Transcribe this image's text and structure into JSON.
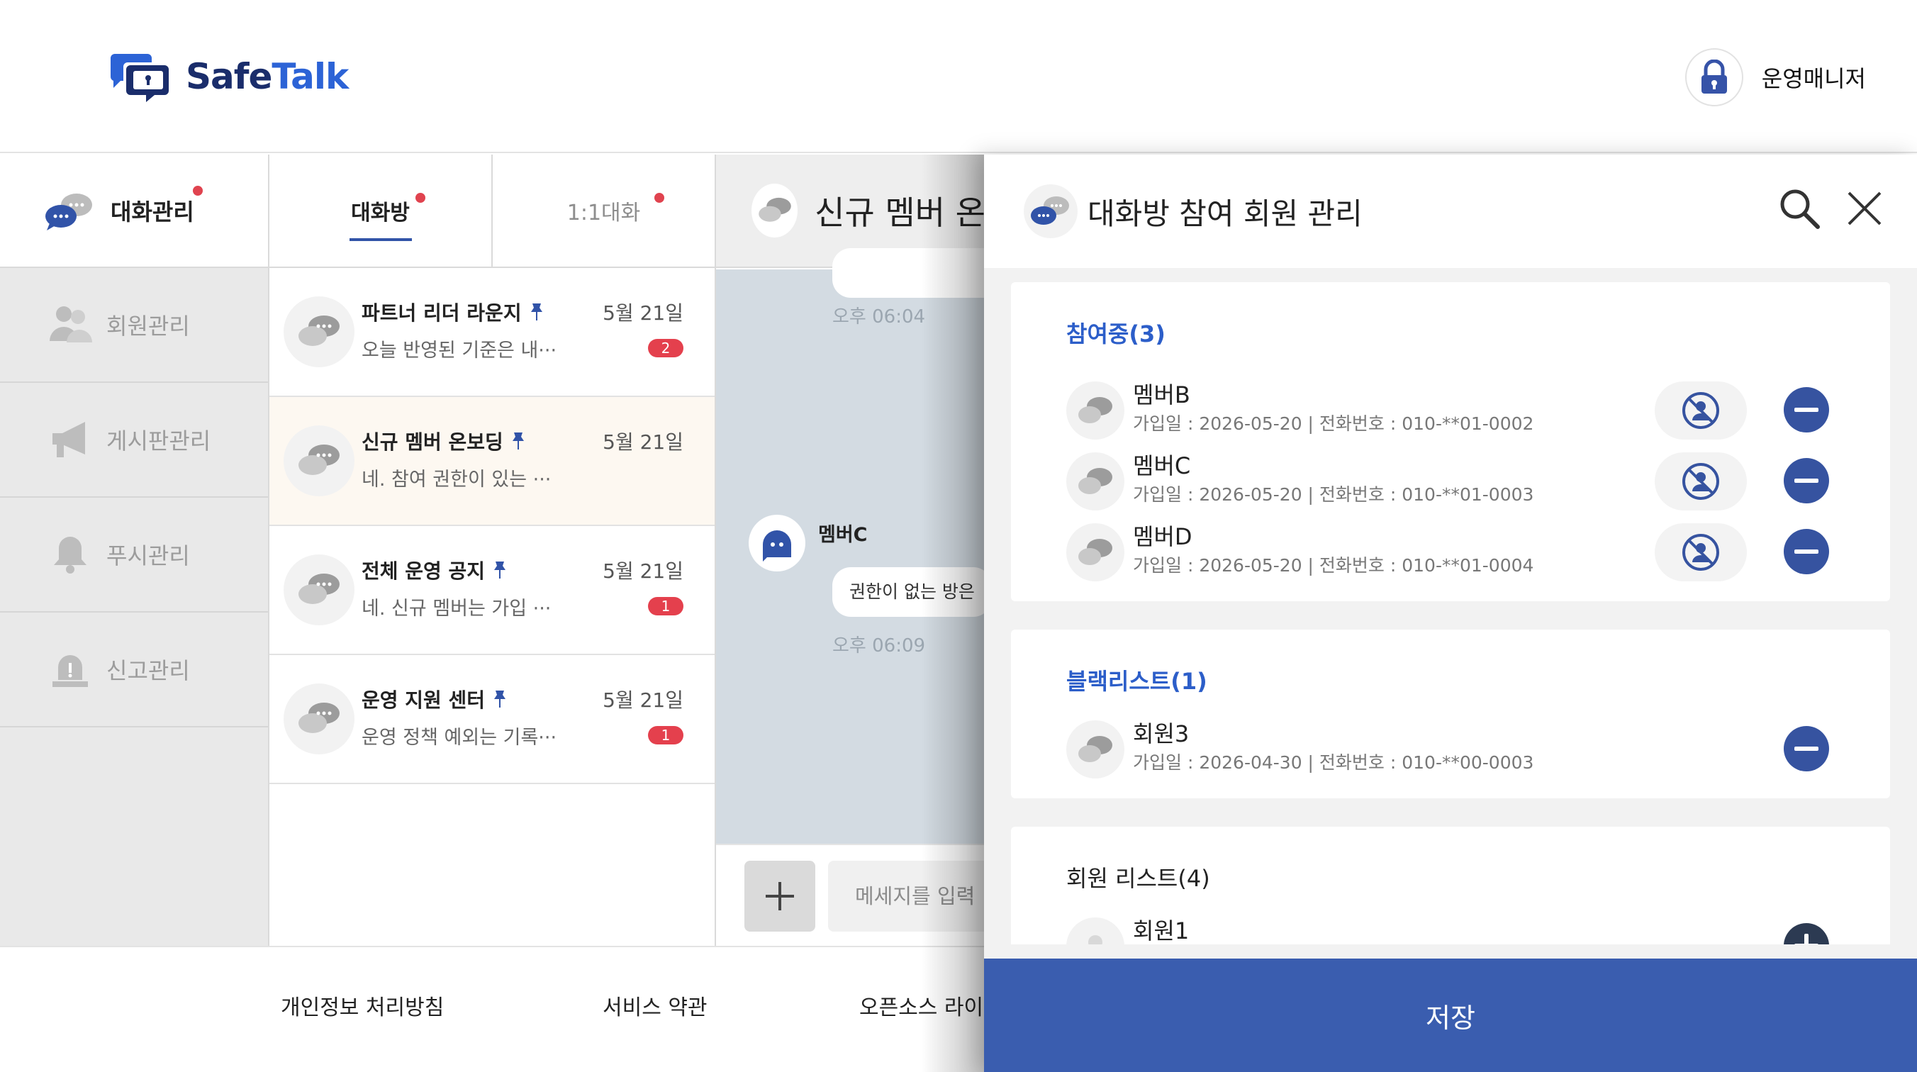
{
  "header": {
    "logo_text_a": "Safe",
    "logo_text_b": "Talk",
    "user_name": "운영매니저"
  },
  "sidebar": {
    "title": "대화관리",
    "items": [
      {
        "label": "회원관리",
        "icon": "members-icon"
      },
      {
        "label": "게시판관리",
        "icon": "megaphone-icon"
      },
      {
        "label": "푸시관리",
        "icon": "bell-icon"
      },
      {
        "label": "신고관리",
        "icon": "alarm-light-icon"
      }
    ]
  },
  "room_tabs": [
    {
      "label": "대화방",
      "active": true
    },
    {
      "label": "1:1대화",
      "active": false
    }
  ],
  "rooms": [
    {
      "name": "파트너 리더 라운지",
      "preview": "오늘 반영된 기준은 내···",
      "date": "5월 21일",
      "badge": "2"
    },
    {
      "name": "신규 멤버 온보딩",
      "preview": "네. 참여 권한이 있는 ···",
      "date": "5월 21일",
      "badge": ""
    },
    {
      "name": "전체 운영 공지",
      "preview": "네. 신규 멤버는 가입 ···",
      "date": "5월 21일",
      "badge": "1"
    },
    {
      "name": "운영 지원 센터",
      "preview": "운영 정책 예외는 기록···",
      "date": "5월 21일",
      "badge": "1"
    }
  ],
  "chat": {
    "title": "신규 멤버 온",
    "time1": "오후 06:04",
    "sender": "멤버C",
    "message": "권한이 없는 방은",
    "time2": "오후 06:09",
    "input_placeholder": "메세지를 입력"
  },
  "footer": {
    "privacy": "개인정보 처리방침",
    "terms": "서비스 약관",
    "opensource": "오픈소스 라이"
  },
  "panel": {
    "title": "대화방 참여 회원 관리",
    "participating": {
      "title": "참여중(3)",
      "members": [
        {
          "name": "멤버B",
          "info": "가입일 : 2026-05-20 | 전화번호 : 010-**01-0002"
        },
        {
          "name": "멤버C",
          "info": "가입일 : 2026-05-20 | 전화번호 : 010-**01-0003"
        },
        {
          "name": "멤버D",
          "info": "가입일 : 2026-05-20 | 전화번호 : 010-**01-0004"
        }
      ]
    },
    "blacklist": {
      "title": "블랙리스트(1)",
      "members": [
        {
          "name": "회원3",
          "info": "가입일 : 2026-04-30 | 전화번호 : 010-**00-0003"
        }
      ]
    },
    "member_list": {
      "title": "회원 리스트(4)",
      "members": [
        {
          "name": "회원1",
          "info": ""
        }
      ]
    },
    "save_label": "저장"
  },
  "colors": {
    "brand_navy": "#1a2d6b",
    "brand_blue": "#2c63d6",
    "accent": "#3a5daf",
    "badge_red": "#e4404d",
    "section_blue": "#2c5ec9"
  }
}
